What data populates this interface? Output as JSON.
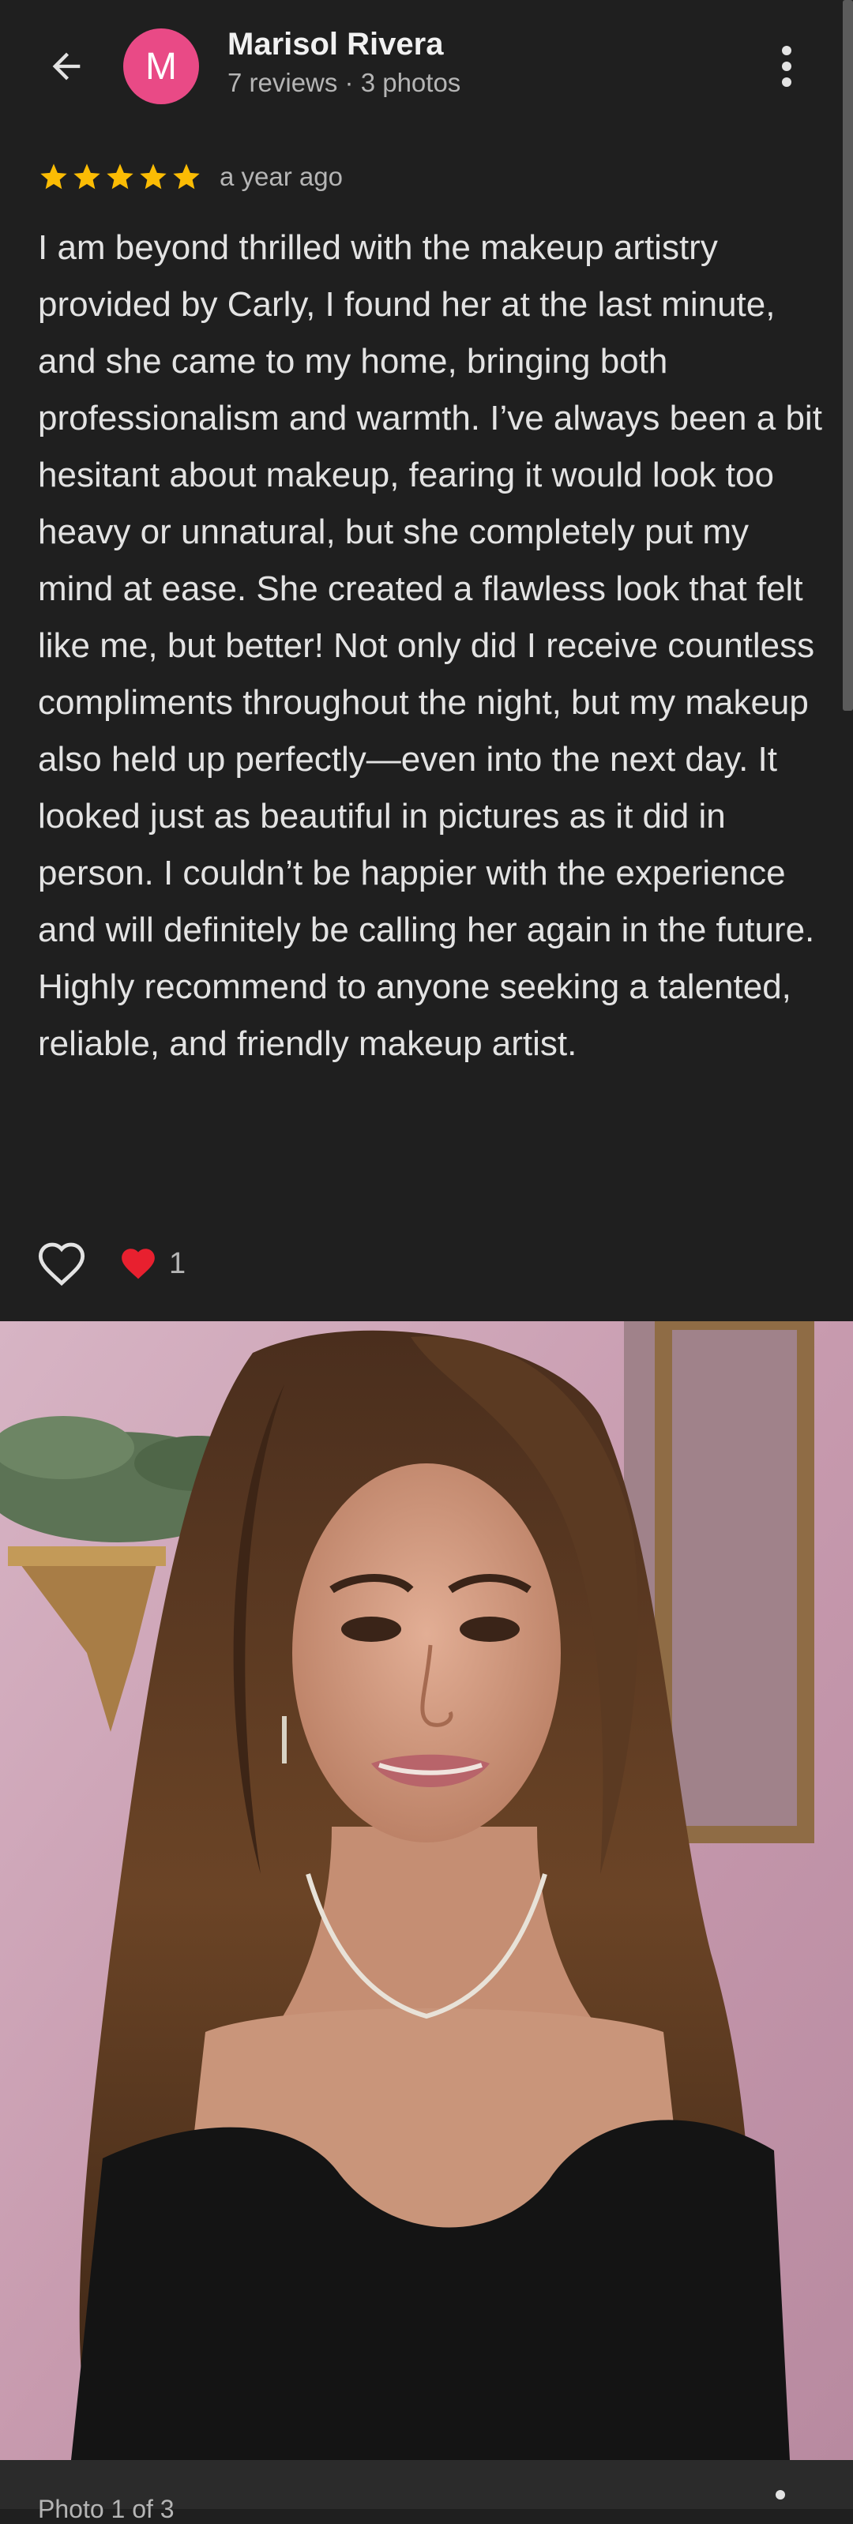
{
  "header": {
    "back_icon": "arrow-back-icon",
    "avatar_letter": "M",
    "avatar_color": "#e94a86",
    "reviewer_name": "Marisol Rivera",
    "reviewer_meta": "7 reviews · 3 photos",
    "more_icon": "more-vert-icon"
  },
  "review": {
    "rating": 5,
    "rating_max": 5,
    "star_color": "#fbbc04",
    "time_ago": "a year ago",
    "text": "I am beyond thrilled with the makeup artistry provided by Carly, I found her at the last minute, and she came to my home, bringing both professionalism and warmth. I’ve always been a bit hesitant about makeup, fearing it would look too heavy or unnatural, but she completely put my mind at ease. She created a flawless look that felt like me, but better! Not only did I receive countless compliments throughout the night, but my makeup also held up perfectly—even into the next day. It looked just as beautiful in pictures as it did in person. I couldn’t be happier with the experience and will definitely be calling her again in the future. Highly recommend to anyone seeking a talented, reliable, and friendly makeup artist."
  },
  "actions": {
    "like_icon": "heart-outline-icon",
    "reaction_icon": "red-heart-icon",
    "reaction_count": "1"
  },
  "photo": {
    "description_icon": "review-photo",
    "counter": "Photo 1 of 3"
  }
}
